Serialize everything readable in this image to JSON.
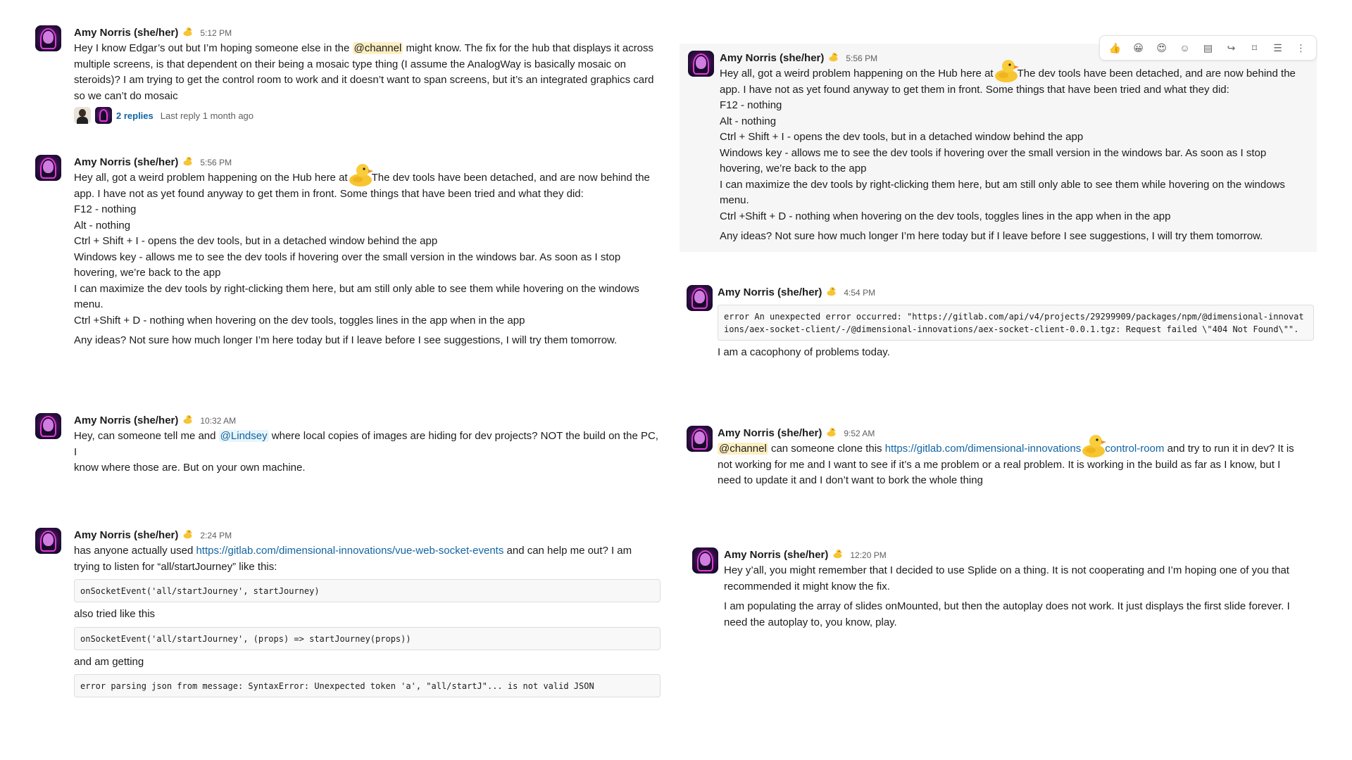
{
  "author": {
    "name": "Amy Norris (she/her)",
    "status_emoji": "rubber-duck"
  },
  "hover_toolbar": {
    "buttons": [
      "thumbs-up-icon",
      "grinning-emoji-icon",
      "heart-eyes-emoji-icon",
      "add-reaction-icon",
      "reply-in-thread-icon",
      "forward-icon",
      "bookmark-icon",
      "more-actions-icon",
      "kebab-icon"
    ]
  },
  "messages": {
    "m1": {
      "time": "5:12 PM",
      "l1a": "Hey I know Edgar’s out but I’m hoping someone else in the ",
      "l1_mention": "@channel",
      "l1b": " might know. The fix for the hub that displays it across",
      "l2": "multiple screens, is that dependent on their being a mosaic type thing (I assume the AnalogWay is basically mosaic on",
      "l3": "steroids)? I am trying to get the control room to work and it doesn’t want to span screens, but it’s an integrated graphics card",
      "l4": "so we can’t do mosaic",
      "replies_count": "2 replies",
      "replies_last": "Last reply 1 month ago"
    },
    "m2": {
      "time": "5:56 PM",
      "l1a": "Hey all, got a weird problem happening on the Hub here at",
      "l1b": "The dev tools have been detached, and are now behind the",
      "l2": "app. I have not as yet found anyway to get them in front.  Some things that have been tried and what they did:",
      "l3": "F12 -  nothing",
      "l4": "Alt - nothing",
      "l5": "Ctrl + Shift + I - opens the dev tools, but in a detached window behind the app",
      "l6": "Windows key - allows me to see the dev tools if hovering over the small version in the windows bar. As soon as I stop",
      "l7": "hovering, we’re back to the app",
      "l8": "I can maximize the dev tools by right-clicking them here, but am still only able to see them while hovering on the windows",
      "l9": "menu.",
      "l10": "Ctrl +Shift + D - nothing when hovering on the dev tools, toggles lines in the app when in the app",
      "l11": "Any ideas? Not sure how much longer I’m here today but if I leave before I see suggestions, I will try them tomorrow."
    },
    "m3": {
      "time": "10:32 AM",
      "l1a": "Hey, can someone tell me and ",
      "l1_mention": "@Lindsey",
      "l1b": " where local copies of images are hiding for dev projects? NOT the build on the PC, I",
      "l2": "know where those are. But on your own machine."
    },
    "m4": {
      "time": "2:24 PM",
      "l1a": "has anyone actually used ",
      "l1_link": "https://gitlab.com/dimensional-innovations/vue-web-socket-events",
      "l1b": " and can help me out? I am",
      "l2": "trying to listen for “all/startJourney” like this:",
      "code1": "onSocketEvent('all/startJourney', startJourney)",
      "l3": "also tried like this",
      "code2": "onSocketEvent('all/startJourney', (props) => startJourney(props))",
      "l4": "and am getting",
      "code3": "error parsing json from message: SyntaxError: Unexpected token 'a', \"all/startJ\"... is not valid JSON"
    },
    "m5": {
      "time": "5:56 PM",
      "l1a": "Hey all, got a weird problem happening on the Hub here at",
      "l1b": "The dev tools have been detached, and are now behind the",
      "l2": "app. I have not as yet found anyway to get them in front.  Some things that have been tried and what they did:",
      "l3": "F12 -  nothing",
      "l4": "Alt - nothing",
      "l5": "Ctrl + Shift + I - opens the dev tools, but in a detached window behind the app",
      "l6": "Windows key - allows me to see the dev tools if hovering over the small version in the windows bar. As soon as I stop",
      "l7": "hovering, we’re back to the app",
      "l8": "I can maximize the dev tools by right-clicking them here, but am still only able to see them while hovering on the windows",
      "l9": "menu.",
      "l10": "Ctrl +Shift + D - nothing when hovering on the dev tools, toggles lines in the app when in the app",
      "l11": "Any ideas? Not sure how much longer I’m here today but if I leave before I see suggestions, I will try them tomorrow."
    },
    "m6": {
      "time": "4:54 PM",
      "code": "error An unexpected error occurred: \"https://gitlab.com/api/v4/projects/29299909/packages/npm/@dimensional-innovations/aex-socket-client/-/@dimensional-innovations/aex-socket-client-0.0.1.tgz: Request failed \\\"404 Not Found\\\"\".",
      "l1": "I am a cacophony of problems today."
    },
    "m7": {
      "time": "9:52 AM",
      "l1_mention": "@channel",
      "l1a": " can someone clone this ",
      "l1_link_a": "https://gitlab.com/dimensional-innovations",
      "l1_link_b": "control-room",
      "l1b": " and try to run it in dev? It is",
      "l2": "not working for me and I want to see if it’s a me problem or a real problem. It is working in the build as far as I know, but I",
      "l3": "need to update it and I don’t want to bork the whole thing"
    },
    "m8": {
      "time": "12:20 PM",
      "l1": "Hey y’all, you might remember that I decided to use Splide on a thing. It is not cooperating and I’m hoping one of you that",
      "l2": "recommended it might know the fix.",
      "l3": "I am populating the array of slides onMounted, but then the autoplay does not work. It just displays the first slide forever. I",
      "l4": "need the autoplay to, you know, play."
    }
  }
}
